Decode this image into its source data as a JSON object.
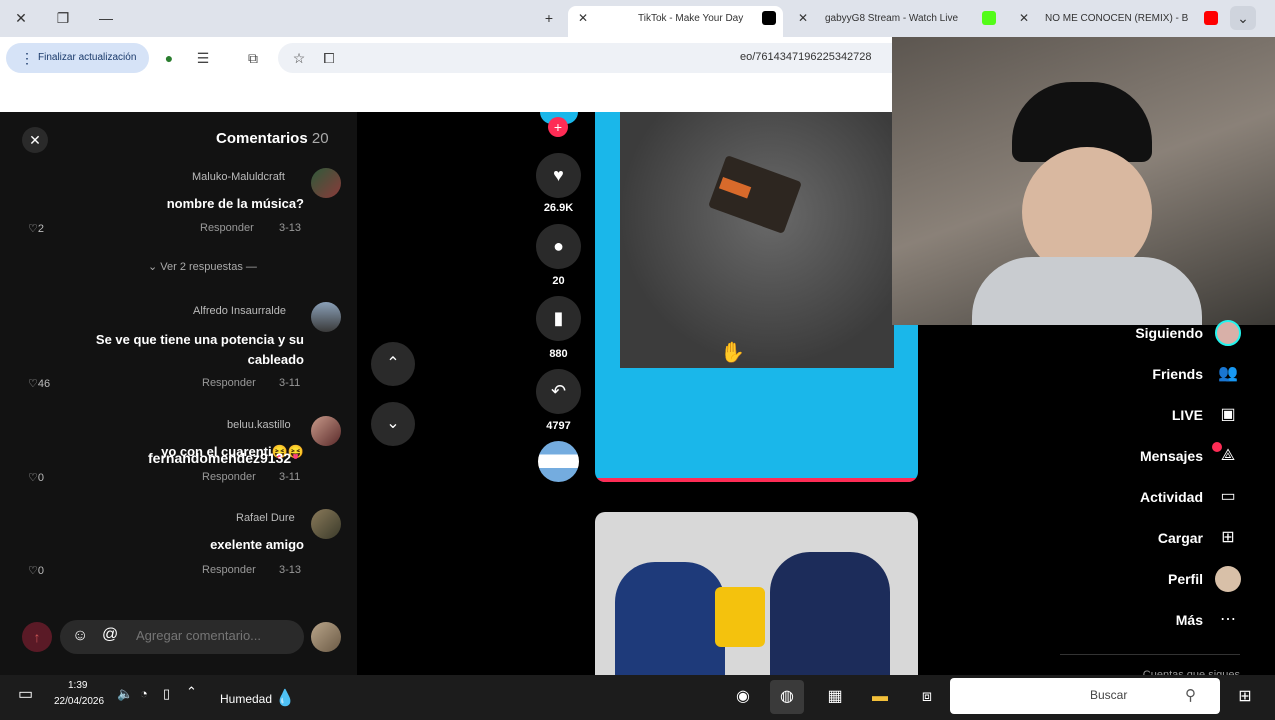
{
  "browser": {
    "tabs": [
      {
        "title": "NO ME CONOCEN (REMIX) - B",
        "icon": "youtube-icon",
        "color": "#ff0000"
      },
      {
        "title": "gabyyG8 Stream - Watch Live",
        "icon": "kick-icon",
        "color": "#53fc18"
      },
      {
        "title": "TikTok - Make Your Day",
        "icon": "tiktok-icon",
        "color": "#000000"
      }
    ],
    "url": "eo/7614347196225342728",
    "update_label": "Finalizar actualización"
  },
  "comments": {
    "title": "Comentarios",
    "count": "20",
    "view_replies": "Ver 2 respuestas",
    "placeholder": "Agregar comentario...",
    "items": [
      {
        "user": "Maluko-Maluldcraft",
        "text": "nombre de la música?",
        "date": "3-13",
        "reply": "Responder",
        "likes": "2"
      },
      {
        "user": "Alfredo Insaurralde",
        "text": "Se ve que tiene una potencia y su cableado",
        "date": "3-11",
        "reply": "Responder",
        "likes": "46"
      },
      {
        "user": "beluu.kastillo",
        "text": "yo con el cuarenti😝😝",
        "date": "3-11",
        "reply": "Responder",
        "likes": "0"
      },
      {
        "user": "Rafael Dure",
        "text": "exelente amigo",
        "date": "3-13",
        "reply": "Responder",
        "likes": "0"
      }
    ]
  },
  "actions": {
    "likes": "26.9K",
    "comments": "20",
    "saves": "880",
    "shares": "4797"
  },
  "video": {
    "username": "fernandomendez9132"
  },
  "sidebar": {
    "items": [
      {
        "label": "Siguiendo",
        "icon": "avatar-icon"
      },
      {
        "label": "Friends",
        "icon": "friends-icon"
      },
      {
        "label": "LIVE",
        "icon": "live-icon"
      },
      {
        "label": "Mensajes",
        "icon": "messages-icon"
      },
      {
        "label": "Actividad",
        "icon": "activity-icon"
      },
      {
        "label": "Cargar",
        "icon": "upload-icon"
      },
      {
        "label": "Perfil",
        "icon": "profile-icon"
      },
      {
        "label": "Más",
        "icon": "more-icon"
      }
    ],
    "footer_partial": "Cuentas que sigues"
  },
  "taskbar": {
    "search_label": "Buscar",
    "time": "1:39",
    "date": "22/04/2026",
    "weather": "Humedad"
  },
  "colors": {
    "tiktok_red": "#fe2c55",
    "video_bg": "#1ab7ea"
  }
}
